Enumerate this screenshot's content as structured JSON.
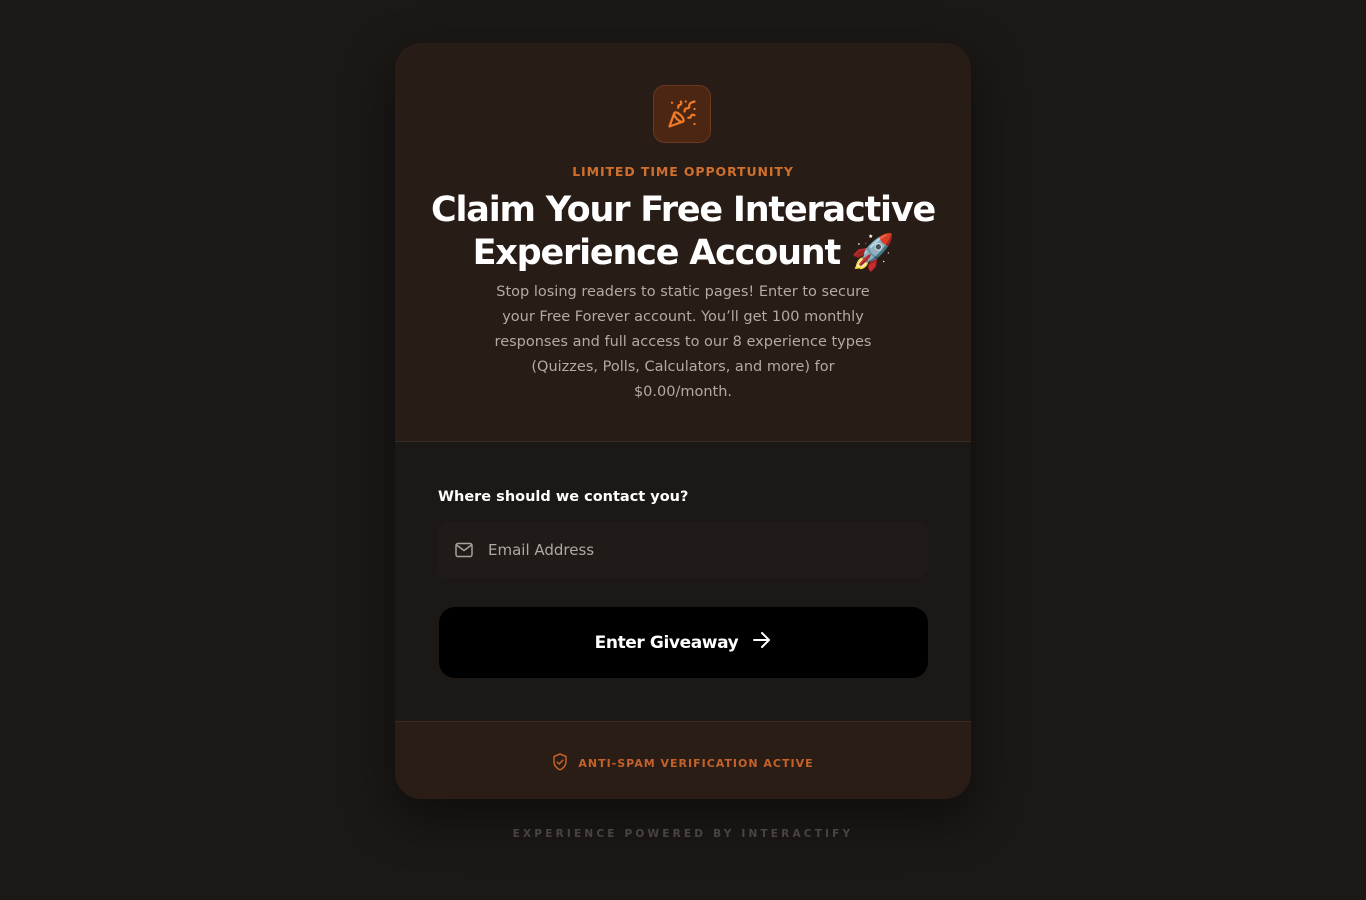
{
  "hero": {
    "icon": "party-popper-icon",
    "eyebrow": "LIMITED TIME OPPORTUNITY",
    "title": "Claim Your Free Interactive Experience Account 🚀",
    "description": "Stop losing readers to static pages! Enter to secure your Free Forever account. You’ll get 100 monthly responses and full access to our 8 experience types (Quizzes, Polls, Calculators, and more) for $0.00/month."
  },
  "form": {
    "label": "Where should we contact you?",
    "email_icon": "mail-icon",
    "email_placeholder": "Email Address",
    "email_value": "",
    "submit_label": "Enter Giveaway",
    "submit_icon": "arrow-right-icon"
  },
  "footer": {
    "spam_icon": "shield-check-icon",
    "spam_text": "ANTI-SPAM VERIFICATION ACTIVE",
    "powered_by": "EXPERIENCE POWERED BY INTERACTIFY"
  },
  "colors": {
    "page_bg": "#1b1816",
    "hero_bg": "#271c16",
    "accent": "#d0702c",
    "button_bg": "#000000"
  }
}
